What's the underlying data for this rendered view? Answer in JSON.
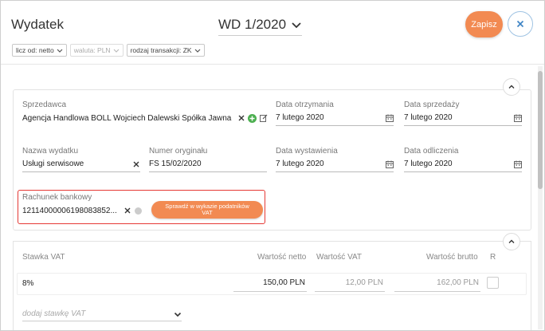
{
  "header": {
    "title": "Wydatek",
    "document_number": "WD 1/2020",
    "save_label": "Zapisz"
  },
  "filters": [
    {
      "label": "licz od: netto",
      "disabled": false
    },
    {
      "label": "waluta: PLN",
      "disabled": true
    },
    {
      "label": "rodzaj transakcji: ZK",
      "disabled": false
    }
  ],
  "form": {
    "seller": {
      "label": "Sprzedawca",
      "value": "Agencja Handlowa BOLL Wojciech Dalewski Spółka Jawna"
    },
    "receipt_date": {
      "label": "Data otrzymania",
      "value": "7 lutego 2020"
    },
    "sale_date": {
      "label": "Data sprzedaży",
      "value": "7 lutego 2020"
    },
    "expense_name": {
      "label": "Nazwa wydatku",
      "value": "Usługi serwisowe"
    },
    "original_number": {
      "label": "Numer oryginału",
      "value": "FS 15/02/2020"
    },
    "issue_date": {
      "label": "Data wystawienia",
      "value": "7 lutego 2020"
    },
    "deduction_date": {
      "label": "Data odliczenia",
      "value": "7 lutego 2020"
    },
    "bank_account": {
      "label": "Rachunek bankowy",
      "value": "12114000006198083852..."
    },
    "verify_button": "Sprawdź w wykazie podatników VAT"
  },
  "vat_table": {
    "headers": {
      "rate": "Stawka VAT",
      "net": "Wartość netto",
      "vat": "Wartość VAT",
      "gross": "Wartość brutto",
      "r": "R"
    },
    "rows": [
      {
        "rate": "8%",
        "net": "150,00 PLN",
        "vat": "12,00 PLN",
        "gross": "162,00 PLN"
      }
    ],
    "add_placeholder": "dodaj stawkę VAT"
  },
  "colors": {
    "accent": "#f28a52",
    "close_border": "#9fc3e3",
    "highlight_border": "#e53935",
    "add_icon": "#4caf50"
  },
  "icons": [
    "chevron-down-icon",
    "close-icon",
    "add-circle-icon",
    "edit-icon",
    "calendar-icon",
    "chevron-up-icon"
  ]
}
